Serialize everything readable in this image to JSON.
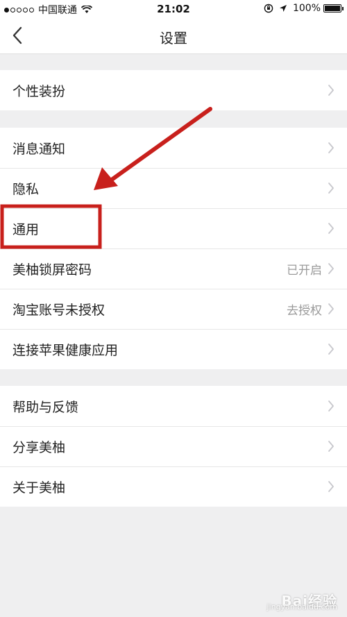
{
  "status_bar": {
    "carrier": "中国联通",
    "time": "21:02",
    "battery": "100%",
    "battery_level": 1.0,
    "signal_dots_filled": 1,
    "signal_dots_total": 5
  },
  "nav": {
    "title": "设置",
    "back_icon": "chevron-left-icon"
  },
  "groups": [
    {
      "items": [
        {
          "label": "个性装扮",
          "value": ""
        }
      ]
    },
    {
      "items": [
        {
          "label": "消息通知",
          "value": ""
        },
        {
          "label": "隐私",
          "value": ""
        },
        {
          "label": "通用",
          "value": ""
        },
        {
          "label": "美柚锁屏密码",
          "value": "已开启"
        },
        {
          "label": "淘宝账号未授权",
          "value": "去授权"
        },
        {
          "label": "连接苹果健康应用",
          "value": ""
        }
      ]
    },
    {
      "items": [
        {
          "label": "帮助与反馈",
          "value": ""
        },
        {
          "label": "分享美柚",
          "value": ""
        },
        {
          "label": "关于美柚",
          "value": ""
        }
      ]
    }
  ],
  "annotation": {
    "color": "#c8201c",
    "highlight_target": "通用"
  },
  "watermark": {
    "logo_text": "Bai经验",
    "sub_text": "jingyan.baidu.com"
  },
  "colors": {
    "background": "#efeff0",
    "chevron": "#c7c7cc",
    "secondary_text": "#9a9a9a"
  }
}
